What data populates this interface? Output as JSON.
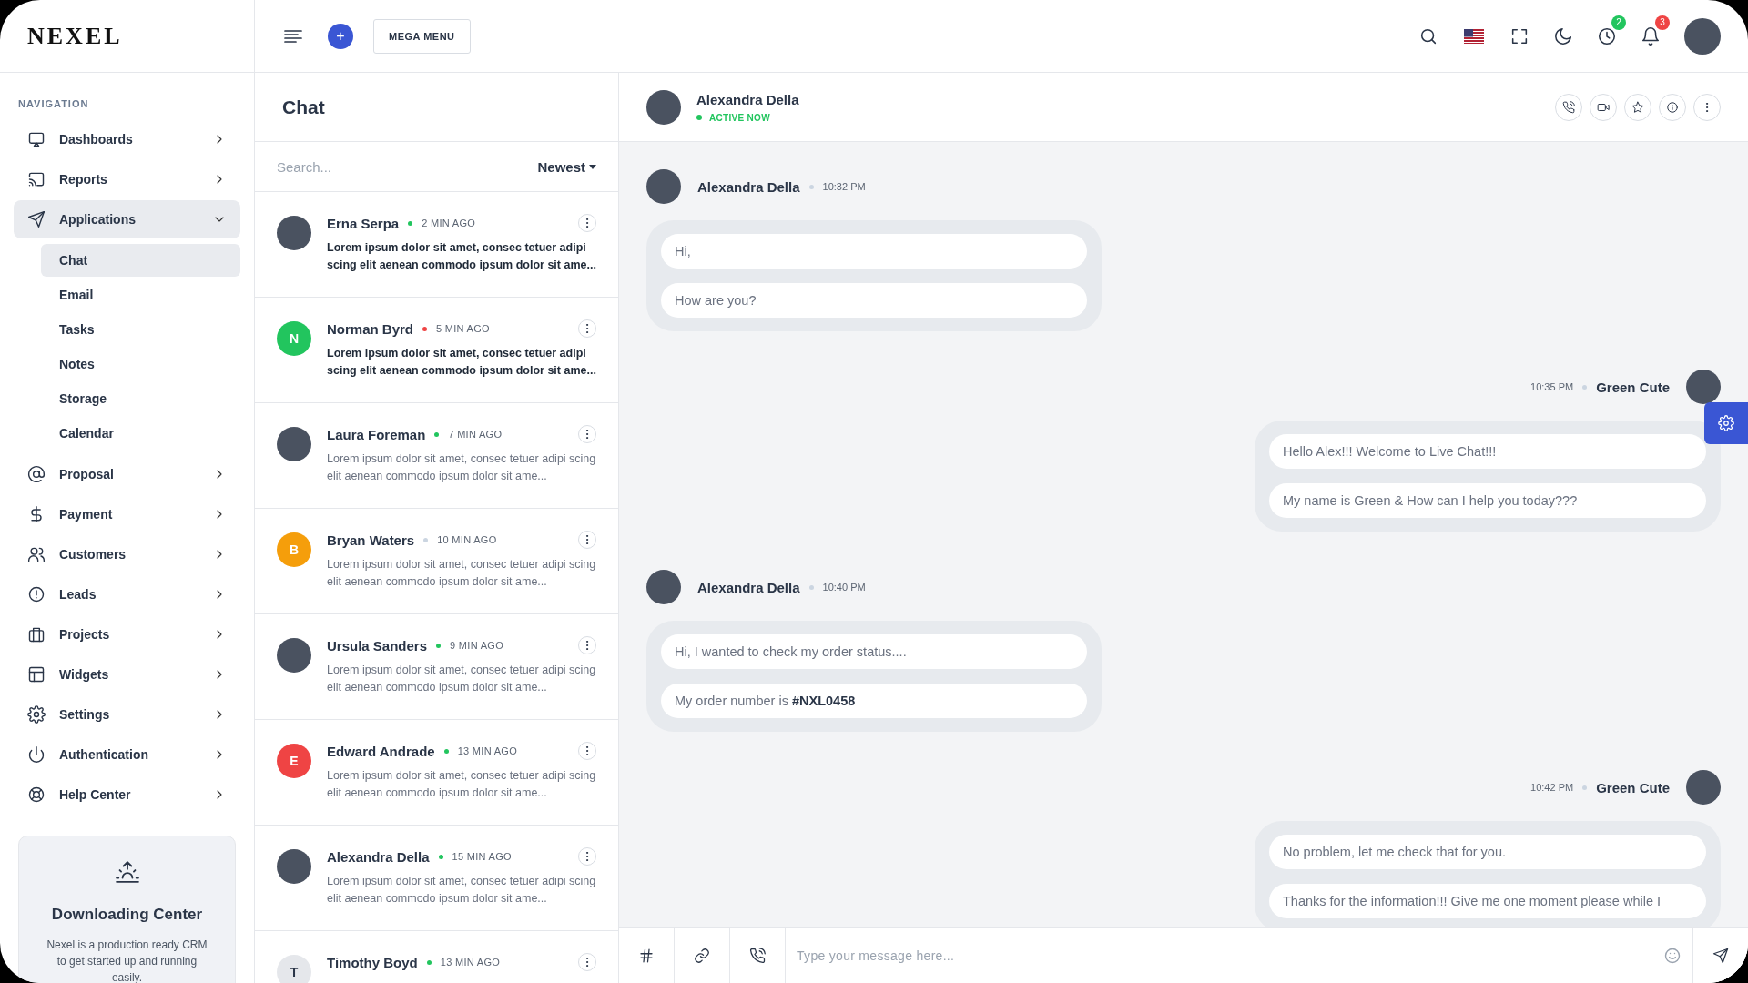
{
  "logo": "NEXEL",
  "sidebar": {
    "heading": "NAVIGATION",
    "items": [
      {
        "label": "Dashboards",
        "expanded": false
      },
      {
        "label": "Reports",
        "expanded": false
      },
      {
        "label": "Applications",
        "expanded": true,
        "children": [
          {
            "label": "Chat",
            "selected": true
          },
          {
            "label": "Email",
            "selected": false
          },
          {
            "label": "Tasks",
            "selected": false
          },
          {
            "label": "Notes",
            "selected": false
          },
          {
            "label": "Storage",
            "selected": false
          },
          {
            "label": "Calendar",
            "selected": false
          }
        ]
      },
      {
        "label": "Proposal",
        "expanded": false
      },
      {
        "label": "Payment",
        "expanded": false
      },
      {
        "label": "Customers",
        "expanded": false
      },
      {
        "label": "Leads",
        "expanded": false
      },
      {
        "label": "Projects",
        "expanded": false
      },
      {
        "label": "Widgets",
        "expanded": false
      },
      {
        "label": "Settings",
        "expanded": false
      },
      {
        "label": "Authentication",
        "expanded": false
      },
      {
        "label": "Help Center",
        "expanded": false
      }
    ],
    "card": {
      "title": "Downloading Center",
      "text": "Nexel is a production ready CRM to get started up and running easily."
    }
  },
  "header": {
    "add_button": "+",
    "mega_menu": "MEGA MENU",
    "badges": [
      {
        "count": "2",
        "color": "#22c55e"
      },
      {
        "count": "3",
        "color": "#ef4444"
      }
    ]
  },
  "chat_list": {
    "title": "Chat",
    "search": {
      "placeholder": "Search..."
    },
    "sort": "Newest",
    "items": [
      {
        "name": "Erna Serpa",
        "time": "2 MIN AGO",
        "color": "#22c55e",
        "avatar": {
          "kind": "photo"
        },
        "unread": true,
        "preview": "Lorem ipsum dolor sit amet, consec tetuer adipi scing elit aenean commodo ipsum dolor sit ame..."
      },
      {
        "name": "Norman Byrd",
        "time": "5 MIN AGO",
        "color": "#ef4444",
        "avatar": {
          "kind": "initial",
          "letter": "N",
          "color": "#22c55e"
        },
        "unread": true,
        "preview": "Lorem ipsum dolor sit amet, consec tetuer adipi scing elit aenean commodo ipsum dolor sit ame..."
      },
      {
        "name": "Laura Foreman",
        "time": "7 MIN AGO",
        "color": "#22c55e",
        "avatar": {
          "kind": "photo"
        },
        "unread": false,
        "preview": "Lorem ipsum dolor sit amet, consec tetuer adipi scing elit aenean commodo ipsum dolor sit ame..."
      },
      {
        "name": "Bryan Waters",
        "time": "10 MIN AGO",
        "color": "#cbd5e1",
        "avatar": {
          "kind": "initial",
          "letter": "B",
          "color": "#f59e0b"
        },
        "unread": false,
        "preview": "Lorem ipsum dolor sit amet, consec tetuer adipi scing elit aenean commodo ipsum dolor sit ame..."
      },
      {
        "name": "Ursula Sanders",
        "time": "9 MIN AGO",
        "color": "#22c55e",
        "avatar": {
          "kind": "photo"
        },
        "unread": false,
        "preview": "Lorem ipsum dolor sit amet, consec tetuer adipi scing elit aenean commodo ipsum dolor sit ame..."
      },
      {
        "name": "Edward Andrade",
        "time": "13 MIN AGO",
        "color": "#22c55e",
        "avatar": {
          "kind": "initial",
          "letter": "E",
          "color": "#ef4444"
        },
        "unread": false,
        "preview": "Lorem ipsum dolor sit amet, consec tetuer adipi scing elit aenean commodo ipsum dolor sit ame..."
      },
      {
        "name": "Alexandra Della",
        "time": "15 MIN AGO",
        "color": "#22c55e",
        "avatar": {
          "kind": "photo"
        },
        "unread": false,
        "preview": "Lorem ipsum dolor sit amet, consec tetuer adipi scing elit aenean commodo ipsum dolor sit ame..."
      },
      {
        "name": "Timothy Boyd",
        "time": "13 MIN AGO",
        "color": "#22c55e",
        "avatar": {
          "kind": "initial",
          "letter": "T",
          "color": "#e5e7eb"
        }
      }
    ]
  },
  "conversation": {
    "name": "Alexandra Della",
    "status": "ACTIVE NOW",
    "groups": [
      {
        "kind": "incoming",
        "sender": "Alexandra Della",
        "time": "10:32 PM",
        "messages": [
          "Hi,",
          "How are you?"
        ]
      },
      {
        "kind": "outgoing",
        "sender": "Green Cute",
        "time": "10:35 PM",
        "messages": [
          "Hello Alex!!! Welcome to Live Chat!!!",
          "My name is Green & How can I help you today???"
        ]
      },
      {
        "kind": "incoming",
        "sender": "Alexandra Della",
        "time": "10:40 PM",
        "messages": [
          "Hi, I wanted to check my order status....",
          "My order number is **#NXL0458**"
        ]
      },
      {
        "kind": "outgoing",
        "sender": "Green Cute",
        "time": "10:42 PM",
        "messages": [
          "No problem, let me check that for you.",
          "Thanks for the information!!! Give me one moment please while I"
        ]
      }
    ],
    "composer": {
      "placeholder": "Type your message here..."
    }
  }
}
